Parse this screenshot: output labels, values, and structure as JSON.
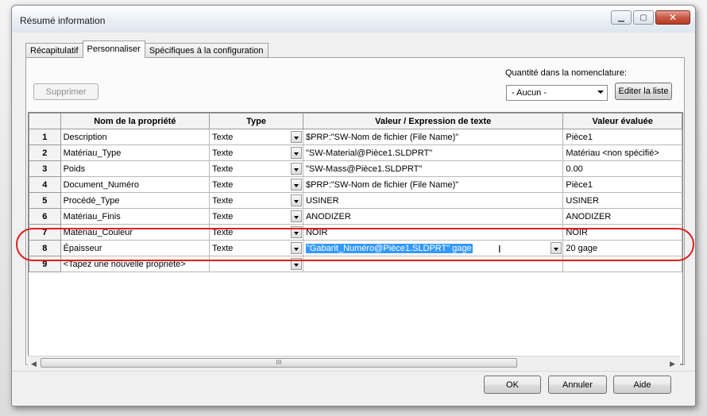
{
  "window": {
    "title": "Résumé information"
  },
  "tabs": [
    "Récapitulatif",
    "Personnaliser",
    "Spécifiques à la configuration"
  ],
  "toolbar": {
    "delete_label": "Supprimer",
    "qty_label": "Quantité dans la nomenclature:",
    "qty_value": "- Aucun -",
    "edit_list_label": "Editer la liste"
  },
  "table": {
    "headers": [
      "",
      "Nom de la propriété",
      "Type",
      "Valeur / Expression de texte",
      "Valeur évaluée"
    ],
    "rows": [
      {
        "num": "1",
        "name": "Description",
        "type": "Texte",
        "value": "$PRP:\"SW-Nom de fichier (File Name)\"",
        "evaluated": "Pièce1"
      },
      {
        "num": "2",
        "name": "Matériau_Type",
        "type": "Texte",
        "value": "\"SW-Material@Pièce1.SLDPRT\"",
        "evaluated": "Matériau <non spécifié>"
      },
      {
        "num": "3",
        "name": "Poids",
        "type": "Texte",
        "value": "\"SW-Mass@Pièce1.SLDPRT\"",
        "evaluated": "0.00"
      },
      {
        "num": "4",
        "name": "Document_Numéro",
        "type": "Texte",
        "value": "$PRP:\"SW-Nom de fichier (File Name)\"",
        "evaluated": "Pièce1"
      },
      {
        "num": "5",
        "name": "Procédé_Type",
        "type": "Texte",
        "value": "USINER",
        "evaluated": "USINER"
      },
      {
        "num": "6",
        "name": "Matériau_Finis",
        "type": "Texte",
        "value": "ANODIZER",
        "evaluated": "ANODIZER"
      },
      {
        "num": "7",
        "name": "Matériau_Couleur",
        "type": "Texte",
        "value": "NOIR",
        "evaluated": "NOIR"
      },
      {
        "num": "8",
        "name": "Épaisseur",
        "type": "Texte",
        "value": "\"Gabarit_Numéro@Pièce1.SLDPRT\" gage",
        "evaluated": "20 gage"
      },
      {
        "num": "9",
        "name": "<Tapez une nouvelle propriété>",
        "type": "",
        "value": "",
        "evaluated": ""
      }
    ]
  },
  "scrollbar": {
    "grip": "III"
  },
  "footer": {
    "ok_label": "OK",
    "cancel_label": "Annuler",
    "help_label": "Aide"
  },
  "colors": {
    "highlight_ring": "#e02020",
    "selection": "#3399ff"
  }
}
